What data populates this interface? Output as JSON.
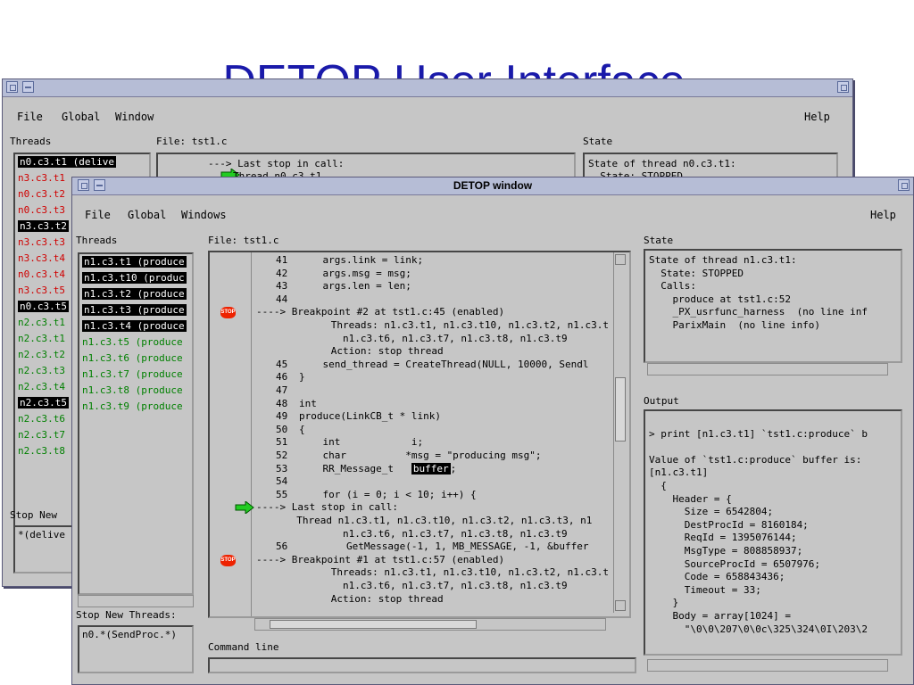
{
  "slide_title": "DETOP User Interface",
  "back_window": {
    "menu": {
      "file": "File",
      "global": "Global",
      "windows": "Window",
      "help": "Help"
    },
    "threads_label": "Threads",
    "threads": [
      {
        "text": "n0.c3.t1 (delive",
        "selected": true,
        "color": "black"
      },
      {
        "text": "n3.c3.t1",
        "selected": false,
        "color": "red"
      },
      {
        "text": "n0.c3.t2",
        "selected": false,
        "color": "red"
      },
      {
        "text": "n0.c3.t3",
        "selected": false,
        "color": "red"
      },
      {
        "text": "n3.c3.t2",
        "selected": true,
        "color": "black"
      },
      {
        "text": "n3.c3.t3",
        "selected": false,
        "color": "red"
      },
      {
        "text": "n3.c3.t4",
        "selected": false,
        "color": "red"
      },
      {
        "text": "n0.c3.t4",
        "selected": false,
        "color": "red"
      },
      {
        "text": "n3.c3.t5",
        "selected": false,
        "color": "red"
      },
      {
        "text": "n0.c3.t5",
        "selected": true,
        "color": "black"
      },
      {
        "text": "n2.c3.t1",
        "selected": false,
        "color": "green"
      },
      {
        "text": "n2.c3.t1",
        "selected": false,
        "color": "green"
      },
      {
        "text": "n2.c3.t2",
        "selected": false,
        "color": "green"
      },
      {
        "text": "n2.c3.t3",
        "selected": false,
        "color": "green"
      },
      {
        "text": "n2.c3.t4",
        "selected": false,
        "color": "green"
      },
      {
        "text": "n2.c3.t5",
        "selected": true,
        "color": "black"
      },
      {
        "text": "n2.c3.t6",
        "selected": false,
        "color": "green"
      },
      {
        "text": "n2.c3.t7",
        "selected": false,
        "color": "green"
      },
      {
        "text": "n2.c3.t8",
        "selected": false,
        "color": "green"
      }
    ],
    "file_label": "File: tst1.c",
    "code_line1": "---> Last stop in call:",
    "code_line2": "Thread n0.c3.t1",
    "state_label": "State",
    "state_line1": "State of thread n0.c3.t1:",
    "state_line2": "  State: STOPPED",
    "stop_new_label": "Stop New",
    "stop_new_value": "*(delive"
  },
  "front_window": {
    "title": "DETOP window",
    "menu": {
      "file": "File",
      "global": "Global",
      "windows": "Windows",
      "help": "Help"
    },
    "threads_label": "Threads",
    "threads": [
      {
        "text": "n1.c3.t1 (produce",
        "selected": true
      },
      {
        "text": "n1.c3.t10 (produc",
        "selected": true
      },
      {
        "text": "n1.c3.t2 (produce",
        "selected": true
      },
      {
        "text": "n1.c3.t3 (produce",
        "selected": true
      },
      {
        "text": "n1.c3.t4 (produce",
        "selected": true
      },
      {
        "text": "n1.c3.t5 (produce",
        "selected": false
      },
      {
        "text": "n1.c3.t6 (produce",
        "selected": false
      },
      {
        "text": "n1.c3.t7 (produce",
        "selected": false
      },
      {
        "text": "n1.c3.t8 (produce",
        "selected": false
      },
      {
        "text": "n1.c3.t9 (produce",
        "selected": false
      }
    ],
    "file_label": "File: tst1.c",
    "code_lines": [
      {
        "num": "41",
        "text": "    args.link = link;",
        "marker": ""
      },
      {
        "num": "42",
        "text": "    args.msg = msg;",
        "marker": ""
      },
      {
        "num": "43",
        "text": "    args.len = len;",
        "marker": ""
      },
      {
        "num": "44",
        "text": "",
        "marker": ""
      },
      {
        "num": "",
        "text": "----> Breakpoint #2 at tst1.c:45 (enabled)",
        "marker": "stop"
      },
      {
        "num": "",
        "text": "      Threads: n1.c3.t1, n1.c3.t10, n1.c3.t2, n1.c3.t",
        "marker": ""
      },
      {
        "num": "",
        "text": "        n1.c3.t6, n1.c3.t7, n1.c3.t8, n1.c3.t9",
        "marker": ""
      },
      {
        "num": "",
        "text": "      Action: stop thread",
        "marker": ""
      },
      {
        "num": "45",
        "text": "    send_thread = CreateThread(NULL, 10000, Sendl",
        "marker": ""
      },
      {
        "num": "46",
        "text": "}",
        "marker": ""
      },
      {
        "num": "47",
        "text": "",
        "marker": ""
      },
      {
        "num": "48",
        "text": "int",
        "marker": ""
      },
      {
        "num": "49",
        "text": "produce(LinkCB_t * link)",
        "marker": ""
      },
      {
        "num": "50",
        "text": "{",
        "marker": ""
      },
      {
        "num": "51",
        "text": "    int            i;",
        "marker": ""
      },
      {
        "num": "52",
        "text": "    char          *msg = \"producing msg\";",
        "marker": ""
      },
      {
        "num": "53",
        "text": "    RR_Message_t   ",
        "marker": "",
        "highlight": "buffer",
        "after": ";"
      },
      {
        "num": "54",
        "text": "",
        "marker": ""
      },
      {
        "num": "55",
        "text": "    for (i = 0; i < 10; i++) {",
        "marker": ""
      },
      {
        "num": "",
        "text": "----> Last stop in call:",
        "marker": "arrow"
      },
      {
        "num": "",
        "text": "  Thread n1.c3.t1, n1.c3.t10, n1.c3.t2, n1.c3.t3, n1",
        "marker": ""
      },
      {
        "num": "",
        "text": "        n1.c3.t6, n1.c3.t7, n1.c3.t8, n1.c3.t9",
        "marker": ""
      },
      {
        "num": "56",
        "text": "        GetMessage(-1, 1, MB_MESSAGE, -1, &buffer",
        "marker": ""
      },
      {
        "num": "",
        "text": "----> Breakpoint #1 at tst1.c:57 (enabled)",
        "marker": "stop"
      },
      {
        "num": "",
        "text": "      Threads: n1.c3.t1, n1.c3.t10, n1.c3.t2, n1.c3.t",
        "marker": ""
      },
      {
        "num": "",
        "text": "        n1.c3.t6, n1.c3.t7, n1.c3.t8, n1.c3.t9",
        "marker": ""
      },
      {
        "num": "",
        "text": "      Action: stop thread",
        "marker": ""
      }
    ],
    "state_label": "State",
    "state_lines": [
      "State of thread n1.c3.t1:",
      "  State: STOPPED",
      "  Calls:",
      "    produce at tst1.c:52",
      "    _PX_usrfunc_harness  (no line inf",
      "    ParixMain  (no line info)"
    ],
    "output_label": "Output",
    "output_lines": [
      "",
      "> print [n1.c3.t1] `tst1.c:produce` b",
      "",
      "Value of `tst1.c:produce` buffer is:",
      "[n1.c3.t1]",
      "  {",
      "    Header = {",
      "      Size = 6542804;",
      "      DestProcId = 8160184;",
      "      ReqId = 1395076144;",
      "      MsgType = 808858937;",
      "      SourceProcId = 6507976;",
      "      Code = 658843436;",
      "      Timeout = 33;",
      "    }",
      "    Body = array[1024] =",
      "      \"\\0\\0\\207\\0\\0c\\325\\324\\0I\\203\\2"
    ],
    "stop_new_label": "Stop New Threads:",
    "stop_new_value": "n0.*(SendProc.*)",
    "command_label": "Command line"
  }
}
